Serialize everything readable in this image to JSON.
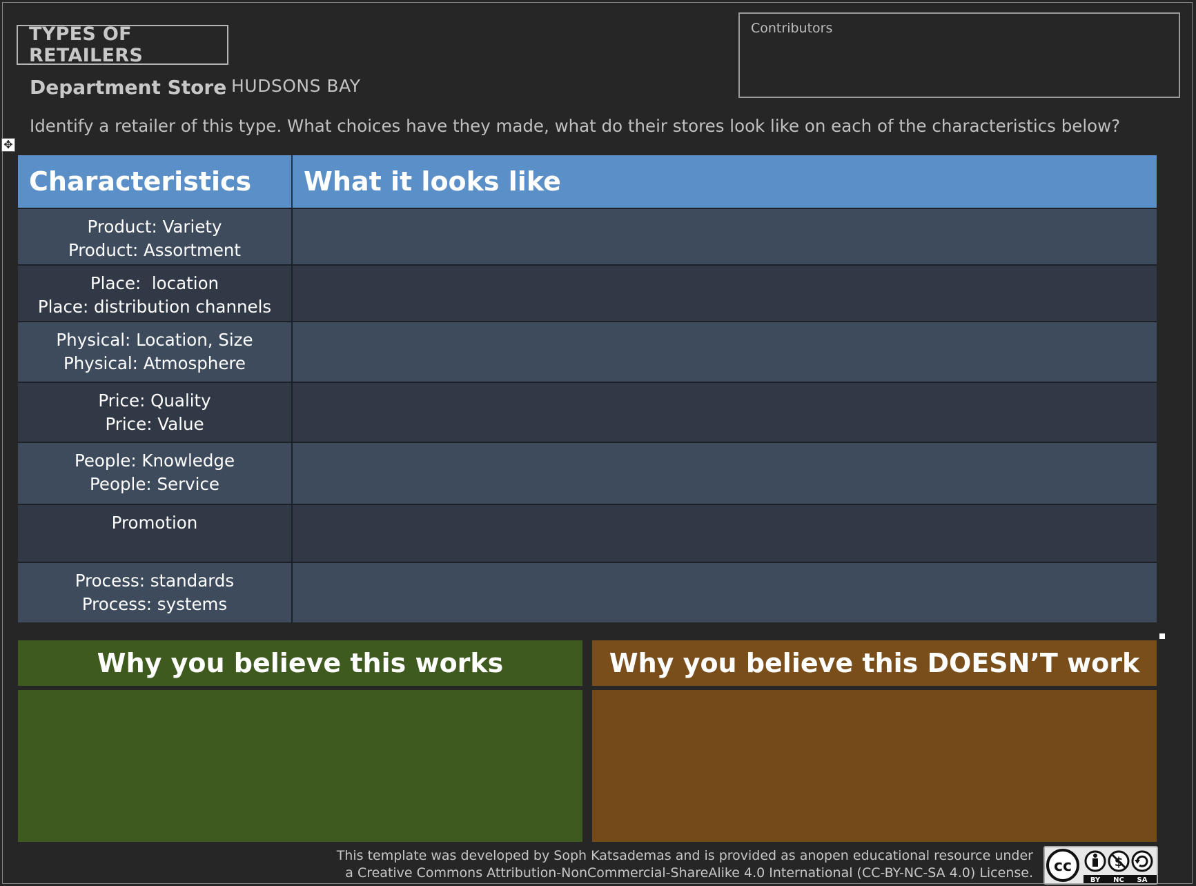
{
  "worksheet": {
    "title": "TYPES OF RETAILERS",
    "retailer_type": "Department Store",
    "retailer_name": "HUDSONS BAY",
    "contributors_label": "Contributors",
    "instructions": "Identify a retailer of this type. What choices have they made, what do their stores look like on each of the characteristics below?"
  },
  "table": {
    "headers": [
      "Characteristics",
      "What it looks like"
    ],
    "rows": [
      {
        "lines": [
          "Product: Variety",
          "Product: Assortment"
        ],
        "value": ""
      },
      {
        "lines": [
          "Place:  location",
          "Place: distribution channels"
        ],
        "value": ""
      },
      {
        "lines": [
          "Physical: Location, Size",
          "Physical: Atmosphere"
        ],
        "value": ""
      },
      {
        "lines": [
          "Price: Quality",
          "Price: Value"
        ],
        "value": ""
      },
      {
        "lines": [
          "People: Knowledge",
          "People: Service"
        ],
        "value": ""
      },
      {
        "lines": [
          "Promotion"
        ],
        "value": ""
      },
      {
        "lines": [
          "Process: standards",
          "Process: systems"
        ],
        "value": ""
      }
    ]
  },
  "verdicts": {
    "works_title": "Why you believe this works",
    "doesnt_title": "Why you believe this DOESN’T work"
  },
  "footer": {
    "line1": "This template was developed by Soph Katsademas and is provided as anopen educational resource under",
    "line2": "a Creative Commons Attribution-NonCommercial-ShareAlike 4.0 International (CC-BY-NC-SA 4.0) License."
  },
  "license_badge": {
    "logo_text": "cc",
    "labels": [
      "BY",
      "NC",
      "SA"
    ]
  },
  "colors": {
    "header_blue": "#5b8fc8",
    "row_light": "#3d4b5c",
    "row_dark": "#313846",
    "works_green": "#3e5a1e",
    "doesnt_brown": "#744b18"
  }
}
